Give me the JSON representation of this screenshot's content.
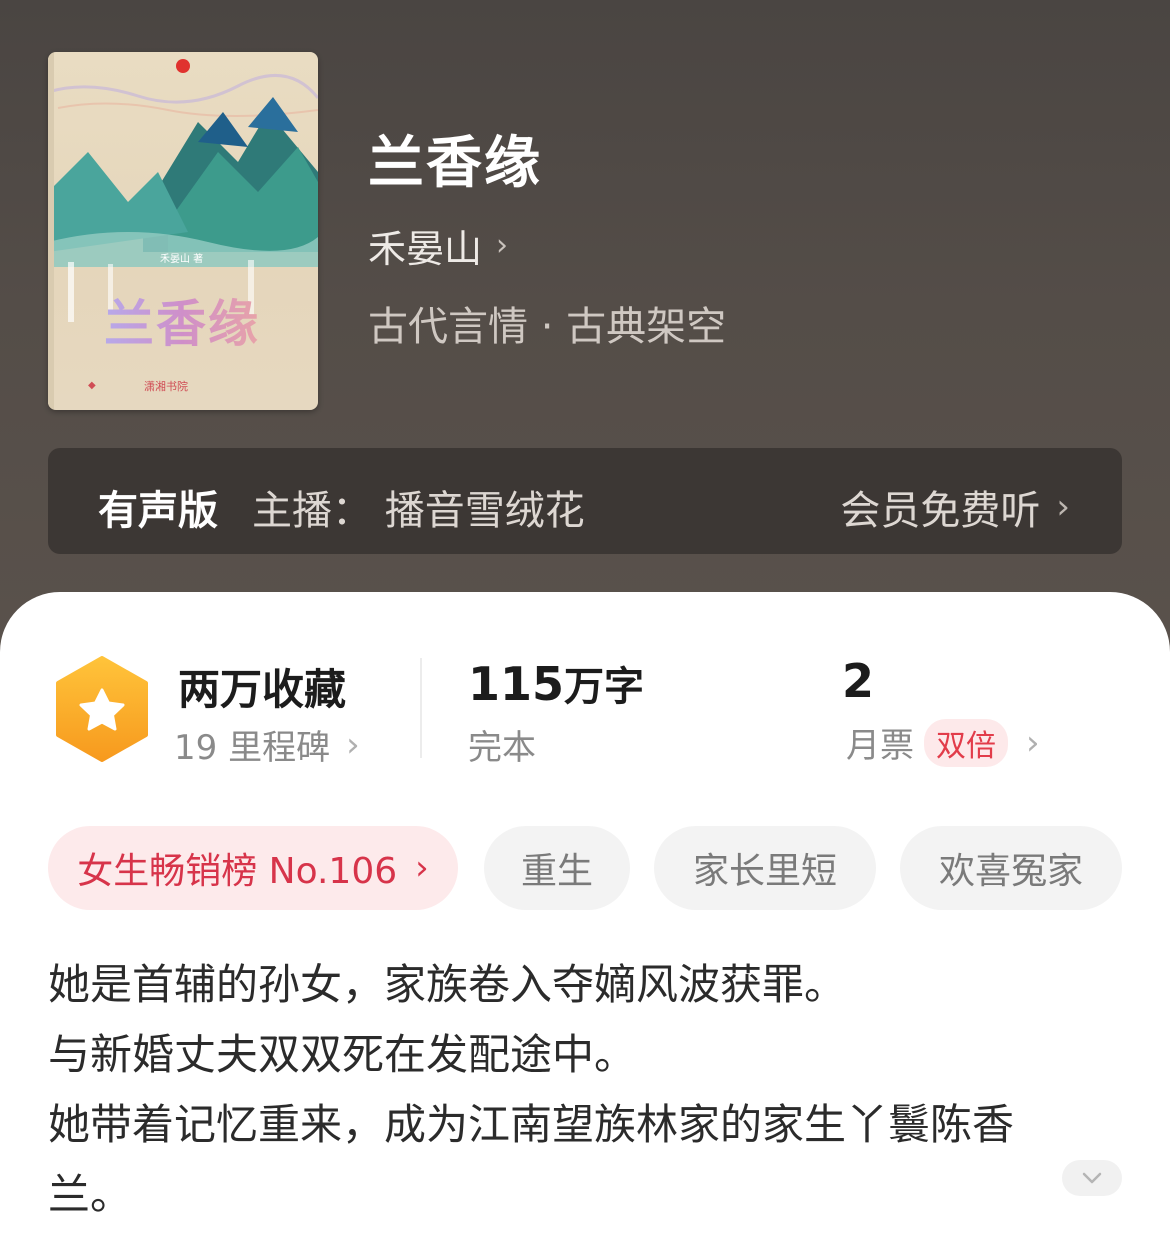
{
  "book": {
    "title": "兰香缘",
    "author": "禾晏山",
    "genre": "古代言情 · 古典架空",
    "cover": {
      "title": "兰香缘",
      "author_line": "禾晏山 著",
      "publisher": "潇湘书院"
    }
  },
  "audio": {
    "label": "有声版",
    "anchor": "主播：  播音雪绒花",
    "action": "会员免费听"
  },
  "stats": {
    "collection": "两万收藏",
    "milestones": "19 里程碑",
    "words_num": "115",
    "words_unit": "万字",
    "status": "完本",
    "monthly_votes": "2",
    "monthly_label": "月票",
    "double_badge": "双倍"
  },
  "tags": [
    {
      "label": "女生畅销榜 No.106"
    },
    {
      "label": "重生"
    },
    {
      "label": "家长里短"
    },
    {
      "label": "欢喜冤家"
    }
  ],
  "description": [
    "她是首辅的孙女，家族卷入夺嫡风波获罪。",
    "与新婚丈夫双双死在发配途中。",
    "她带着记忆重来，成为江南望族林家的家生丫鬟陈香",
    "兰。"
  ],
  "colors": {
    "header_bg": "#524b46",
    "accent_red": "#e23c4a",
    "badge_orange": "#f7a324"
  }
}
